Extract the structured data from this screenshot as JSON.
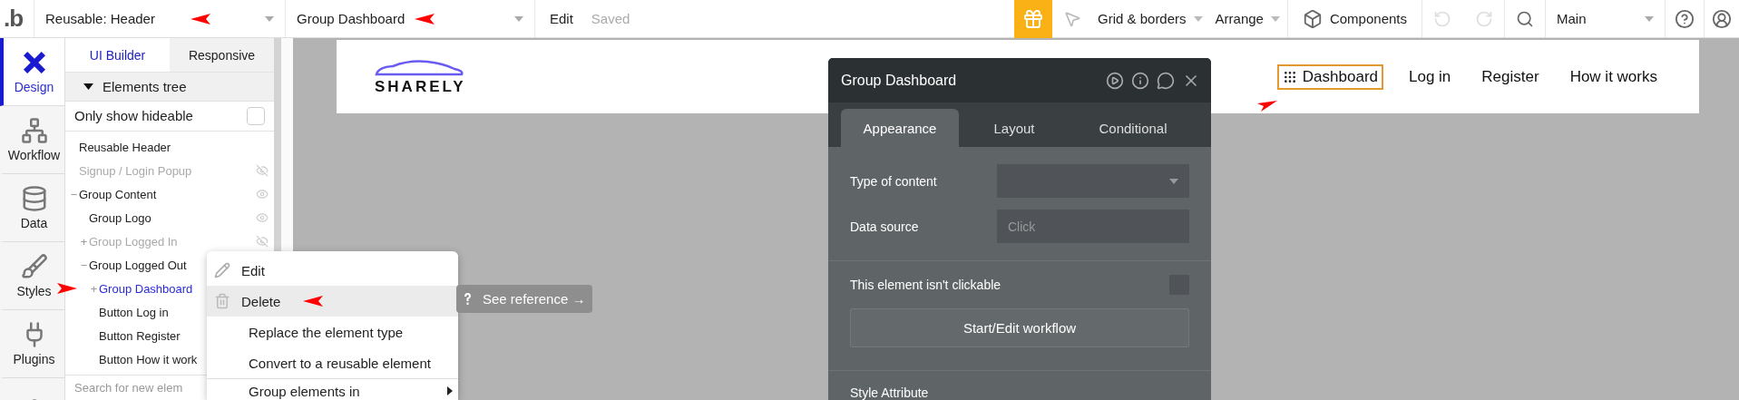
{
  "toolbar": {
    "logo": ".b",
    "page_dropdown": {
      "value": "Reusable: Header",
      "annotated": true
    },
    "element_dropdown": {
      "value": "Group Dashboard",
      "annotated": true
    },
    "edit": "Edit",
    "save_status": "Saved",
    "grid_menu": "Grid & borders",
    "arrange_menu": "Arrange",
    "components": "Components",
    "version_dropdown": "Main"
  },
  "rail": [
    {
      "label": "Design",
      "selected": true
    },
    {
      "label": "Workflow",
      "selected": false
    },
    {
      "label": "Data",
      "selected": false
    },
    {
      "label": "Styles",
      "selected": false
    },
    {
      "label": "Plugins",
      "selected": false
    }
  ],
  "panel": {
    "tabs": [
      {
        "label": "UI Builder",
        "selected": true
      },
      {
        "label": "Responsive",
        "selected": false
      }
    ],
    "tree_title": "Elements tree",
    "filter": {
      "label": "Only show hideable",
      "checked": false
    },
    "tree": [
      {
        "label": "Reusable Header",
        "hidden": false,
        "selected": false
      },
      {
        "label": "Signup / Login Popup",
        "hidden": true,
        "selected": false,
        "eye": true
      },
      {
        "label": "Group Content",
        "hidden": false,
        "selected": false,
        "eye": true,
        "toggle": "−",
        "children": [
          {
            "label": "Group Logo",
            "hidden": false,
            "selected": false,
            "eye": true
          },
          {
            "label": "Group Logged In",
            "hidden": true,
            "selected": false,
            "eye": true,
            "toggle": "+"
          },
          {
            "label": "Group Logged Out",
            "hidden": false,
            "selected": false,
            "toggle": "−",
            "children": [
              {
                "label": "Group Dashboard",
                "hidden": false,
                "selected": true,
                "toggle": "+",
                "annotated": true
              },
              {
                "label": "Button Log in",
                "hidden": false,
                "selected": false
              },
              {
                "label": "Button Register",
                "hidden": false,
                "selected": false
              },
              {
                "label": "Button How it work",
                "hidden": false,
                "selected": false
              }
            ]
          }
        ]
      }
    ],
    "search": {
      "placeholder": "Search for new elem"
    }
  },
  "context_menu": [
    {
      "label": "Edit",
      "highlighted": false
    },
    {
      "label": "Delete",
      "highlighted": true,
      "annotated": true
    },
    {
      "label": "Replace the element type",
      "highlighted": false
    },
    {
      "label": "Convert to a reusable element",
      "highlighted": false
    },
    {
      "label": "Group elements in",
      "highlighted": false,
      "submenu": true,
      "divider_before": true
    }
  ],
  "tooltip": {
    "label": "See reference →"
  },
  "header": {
    "logo": "SHARELY",
    "nav": [
      {
        "label": "Dashboard",
        "selected": true,
        "grid_icon": true,
        "annotated": true
      },
      {
        "label": "Log in",
        "selected": false
      },
      {
        "label": "Register",
        "selected": false
      },
      {
        "label": "How it works",
        "selected": false
      }
    ]
  },
  "property_panel": {
    "title": "Group Dashboard",
    "tabs": [
      {
        "label": "Appearance",
        "selected": true
      },
      {
        "label": "Layout",
        "selected": false
      },
      {
        "label": "Conditional",
        "selected": false
      }
    ],
    "fields": [
      {
        "kind": "dropdown",
        "label": "Type of content"
      },
      {
        "kind": "input",
        "label": "Data source",
        "placeholder": "Click"
      }
    ],
    "checkbox": {
      "label": "This element isn't clickable",
      "checked": false
    },
    "button": "Start/Edit workflow",
    "section": "Style Attribute"
  }
}
